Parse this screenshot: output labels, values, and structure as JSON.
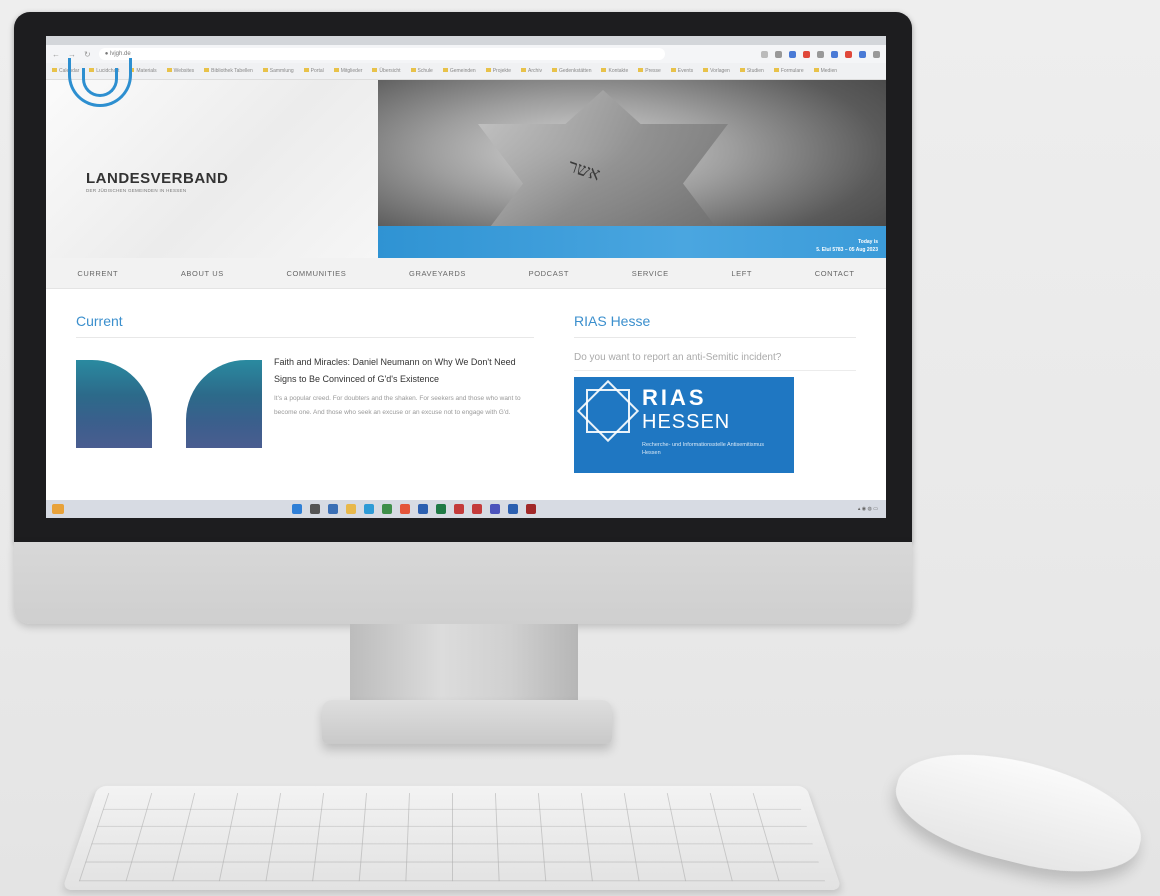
{
  "browser": {
    "url": "lvjgh.de",
    "bookmarks": [
      "Calendar",
      "Lucidchart",
      "Materials",
      "Websites",
      "Bibliothek Tabellen",
      "Sammlung",
      "Portal",
      "Mitglieder",
      "Übersicht",
      "Schule",
      "Gemeinden",
      "Projekte",
      "Archiv",
      "Gedenkstätten",
      "Kontakte",
      "Presse",
      "Events",
      "Vorlagen",
      "Studien",
      "Formulare",
      "Medien"
    ]
  },
  "site": {
    "logo_name": "LANDESVERBAND",
    "logo_sub": "DER JÜDISCHEN GEMEINDEN IN HESSEN",
    "hero_date_line1": "Today is",
    "hero_date_line2": "5. Elul 5783 – 05 Aug 2023"
  },
  "nav": {
    "items": [
      "CURRENT",
      "ABOUT US",
      "COMMUNITIES",
      "GRAVEYARDS",
      "PODCAST",
      "SERVICE",
      "LEFT",
      "CONTACT"
    ]
  },
  "current": {
    "heading": "Current",
    "article_title": "Faith and Miracles: Daniel Neumann on Why We Don't Need Signs to Be Convinced of G'd's Existence",
    "article_excerpt": "It's a popular creed. For doubters and the shaken. For seekers and those who want to become one. And those who seek an excuse or an excuse not to engage with G'd."
  },
  "rias": {
    "heading": "RIAS Hesse",
    "question": "Do you want to report an anti-Semitic incident?",
    "logo_title": "RIAS",
    "logo_sub": "HESSEN",
    "logo_desc": "Recherche- und Informationsstelle Antisemitismus Hessen"
  },
  "colors": {
    "accent": "#3b8fcd",
    "banner": "#2f93d3",
    "rias_blue": "#1f77c2"
  },
  "icons": {
    "browser": [
      "back-icon",
      "reload-icon",
      "lock-icon",
      "star-icon",
      "extension-icon"
    ],
    "taskbar": [
      "start-icon",
      "search-icon",
      "files-icon",
      "edge-icon",
      "mail-icon",
      "chrome-icon",
      "word-icon",
      "excel-icon",
      "teams-icon"
    ]
  }
}
